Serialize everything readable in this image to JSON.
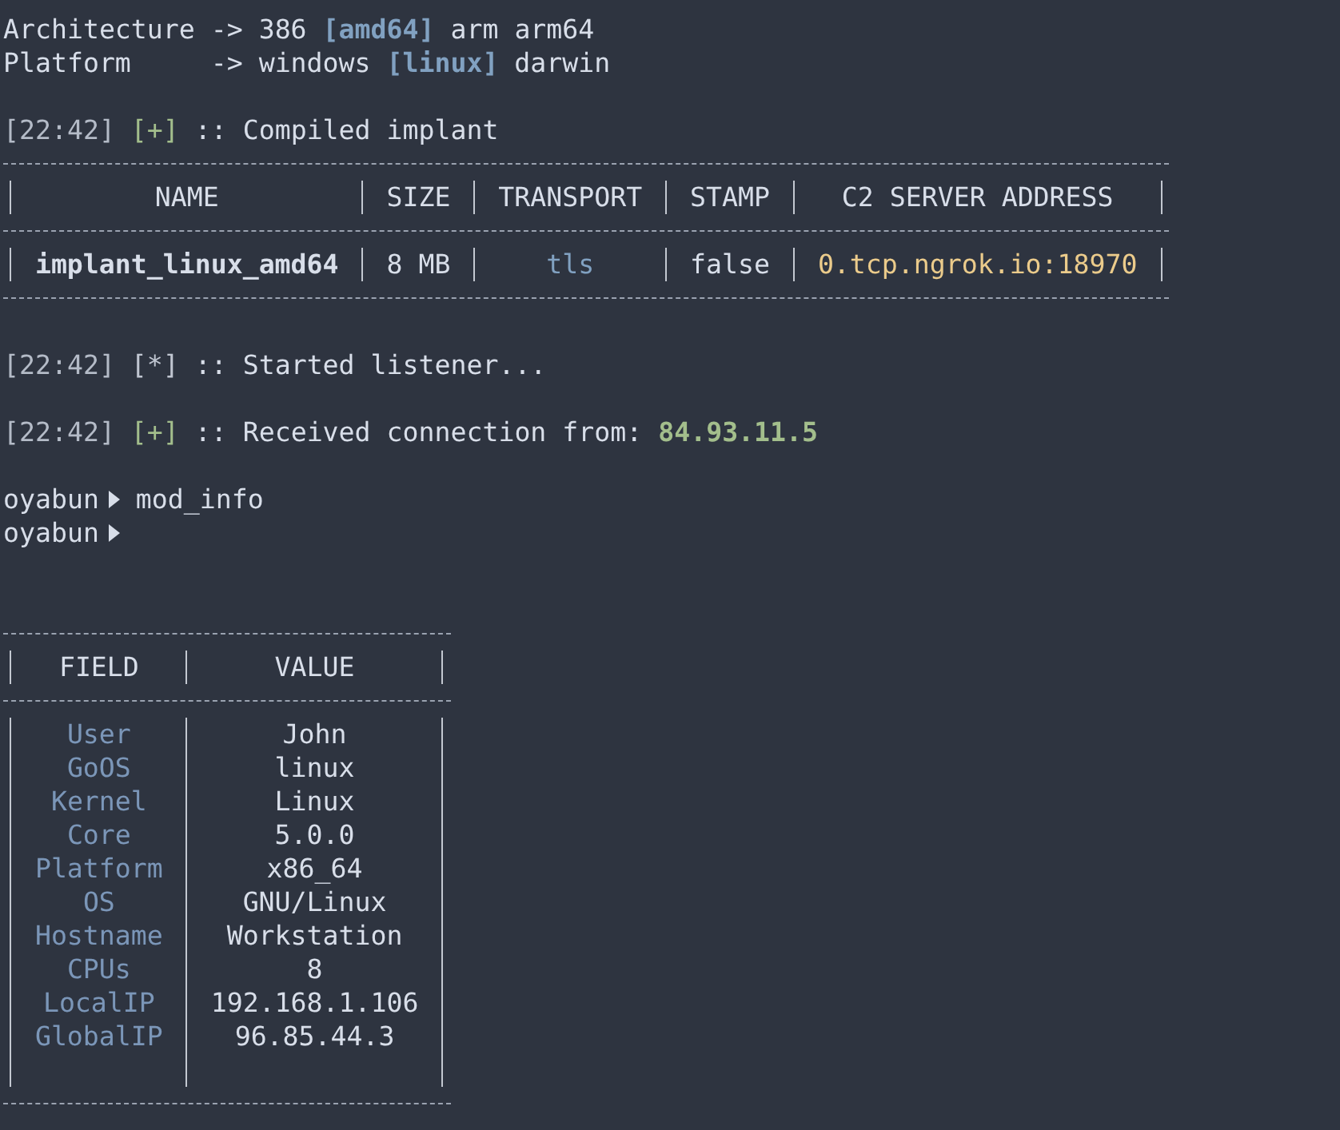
{
  "selectors": [
    {
      "label": "Architecture",
      "arrow": "->",
      "options": [
        {
          "text": "386",
          "selected": false
        },
        {
          "text": "[amd64]",
          "selected": true
        },
        {
          "text": "arm",
          "selected": false
        },
        {
          "text": "arm64",
          "selected": false
        }
      ]
    },
    {
      "label": "Platform",
      "arrow": "->",
      "options": [
        {
          "text": "windows",
          "selected": false
        },
        {
          "text": "[linux]",
          "selected": true
        },
        {
          "text": "darwin",
          "selected": false
        }
      ]
    }
  ],
  "compile_log": {
    "time": "[22:42]",
    "status": "[+]",
    "kind": "success",
    "sep": "::",
    "message": "Compiled implant"
  },
  "implant_table": {
    "columns": [
      "NAME",
      "SIZE",
      "TRANSPORT",
      "STAMP",
      "C2 SERVER ADDRESS"
    ],
    "rows": [
      {
        "name": "implant_linux_amd64",
        "size": "8 MB",
        "transport": "tls",
        "stamp": "false",
        "address": "0.tcp.ngrok.io:18970"
      }
    ]
  },
  "logs": [
    {
      "time": "[22:42]",
      "status": "[*]",
      "kind": "info",
      "sep": "::",
      "message": "Started listener..."
    },
    {
      "time": "[22:42]",
      "status": "[+]",
      "kind": "success",
      "sep": "::",
      "message": "Received connection from:",
      "highlight": "84.93.11.5"
    }
  ],
  "prompts": [
    {
      "user": "oyabun",
      "command": "mod_info"
    },
    {
      "user": "oyabun"
    }
  ],
  "info_table": {
    "columns": [
      "FIELD",
      "VALUE"
    ],
    "rows": [
      {
        "field": "User",
        "value": "John"
      },
      {
        "field": "GoOS",
        "value": "linux"
      },
      {
        "field": "Kernel",
        "value": "Linux"
      },
      {
        "field": "Core",
        "value": "5.0.0"
      },
      {
        "field": "Platform",
        "value": "x86_64"
      },
      {
        "field": "OS",
        "value": "GNU/Linux"
      },
      {
        "field": "Hostname",
        "value": "Workstation"
      },
      {
        "field": "CPUs",
        "value": "8"
      },
      {
        "field": "LocalIP",
        "value": "192.168.1.106"
      },
      {
        "field": "GlobalIP",
        "value": "96.85.44.3"
      },
      {
        "field": "",
        "value": ""
      }
    ]
  }
}
